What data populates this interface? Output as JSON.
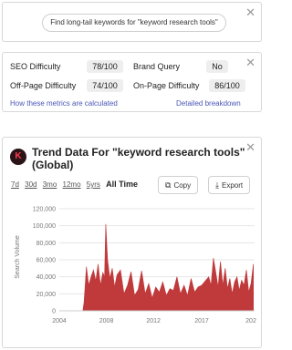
{
  "suggest": {
    "text": "Find long-tail keywords for \"keyword research tools\"",
    "close": "✕"
  },
  "metrics": {
    "close": "✕",
    "seo_difficulty_label": "SEO Difficulty",
    "seo_difficulty_value": "78/100",
    "brand_query_label": "Brand Query",
    "brand_query_value": "No",
    "offpage_label": "Off-Page Difficulty",
    "offpage_value": "74/100",
    "onpage_label": "On-Page Difficulty",
    "onpage_value": "86/100",
    "how_link": "How these metrics are calculated",
    "breakdown_link": "Detailed breakdown"
  },
  "trend": {
    "close": "✕",
    "logo_letter": "K",
    "title": "Trend Data For \"keyword research tools\" (Global)",
    "ranges": [
      "7d",
      "30d",
      "3mo",
      "12mo",
      "5yrs",
      "All Time"
    ],
    "copy_label": "Copy",
    "export_label": "Export",
    "colors": {
      "bar": "#c0393b",
      "grid": "#e6e6e6",
      "axis_text": "#777777"
    }
  },
  "chart_data": {
    "type": "area",
    "title": "",
    "xlabel": "",
    "ylabel": "Search Volume",
    "ylim": [
      0,
      120000
    ],
    "y_ticks": [
      "0",
      "20,000",
      "40,000",
      "60,000",
      "80,000",
      "100,000",
      "120,000"
    ],
    "x_ticks": [
      "2004",
      "2008",
      "2012",
      "2017",
      "202"
    ],
    "xlim": [
      2004,
      2020.6
    ],
    "grid": true,
    "series": [
      {
        "x": [
          2004.0,
          2006.0,
          2006.1,
          2006.3,
          2006.5,
          2006.7,
          2006.9,
          2007.1,
          2007.3,
          2007.5,
          2007.7,
          2007.85,
          2007.95,
          2008.1,
          2008.3,
          2008.5,
          2008.7,
          2008.9,
          2009.2,
          2009.5,
          2009.8,
          2010.1,
          2010.4,
          2010.7,
          2011.0,
          2011.3,
          2011.6,
          2011.9,
          2012.2,
          2012.5,
          2012.8,
          2013.1,
          2013.4,
          2013.7,
          2014.0,
          2014.3,
          2014.6,
          2014.9,
          2015.2,
          2015.5,
          2015.8,
          2016.1,
          2016.4,
          2016.7,
          2016.9,
          2017.1,
          2017.3,
          2017.5,
          2017.7,
          2017.9,
          2018.1,
          2018.3,
          2018.5,
          2018.7,
          2018.9,
          2019.1,
          2019.3,
          2019.5,
          2019.7,
          2019.9,
          2020.1,
          2020.3,
          2020.5
        ],
        "values": [
          0,
          0,
          10000,
          52000,
          30000,
          40000,
          48000,
          35000,
          55000,
          30000,
          45000,
          40000,
          102000,
          60000,
          38000,
          50000,
          28000,
          42000,
          48000,
          20000,
          30000,
          46000,
          18000,
          25000,
          47000,
          20000,
          32000,
          15000,
          28000,
          22000,
          34000,
          18000,
          26000,
          24000,
          40000,
          20000,
          30000,
          18000,
          38000,
          22000,
          28000,
          30000,
          35000,
          40000,
          30000,
          62000,
          45000,
          28000,
          58000,
          30000,
          50000,
          26000,
          38000,
          20000,
          34000,
          40000,
          24000,
          36000,
          30000,
          48000,
          22000,
          32000,
          55000
        ]
      }
    ]
  }
}
